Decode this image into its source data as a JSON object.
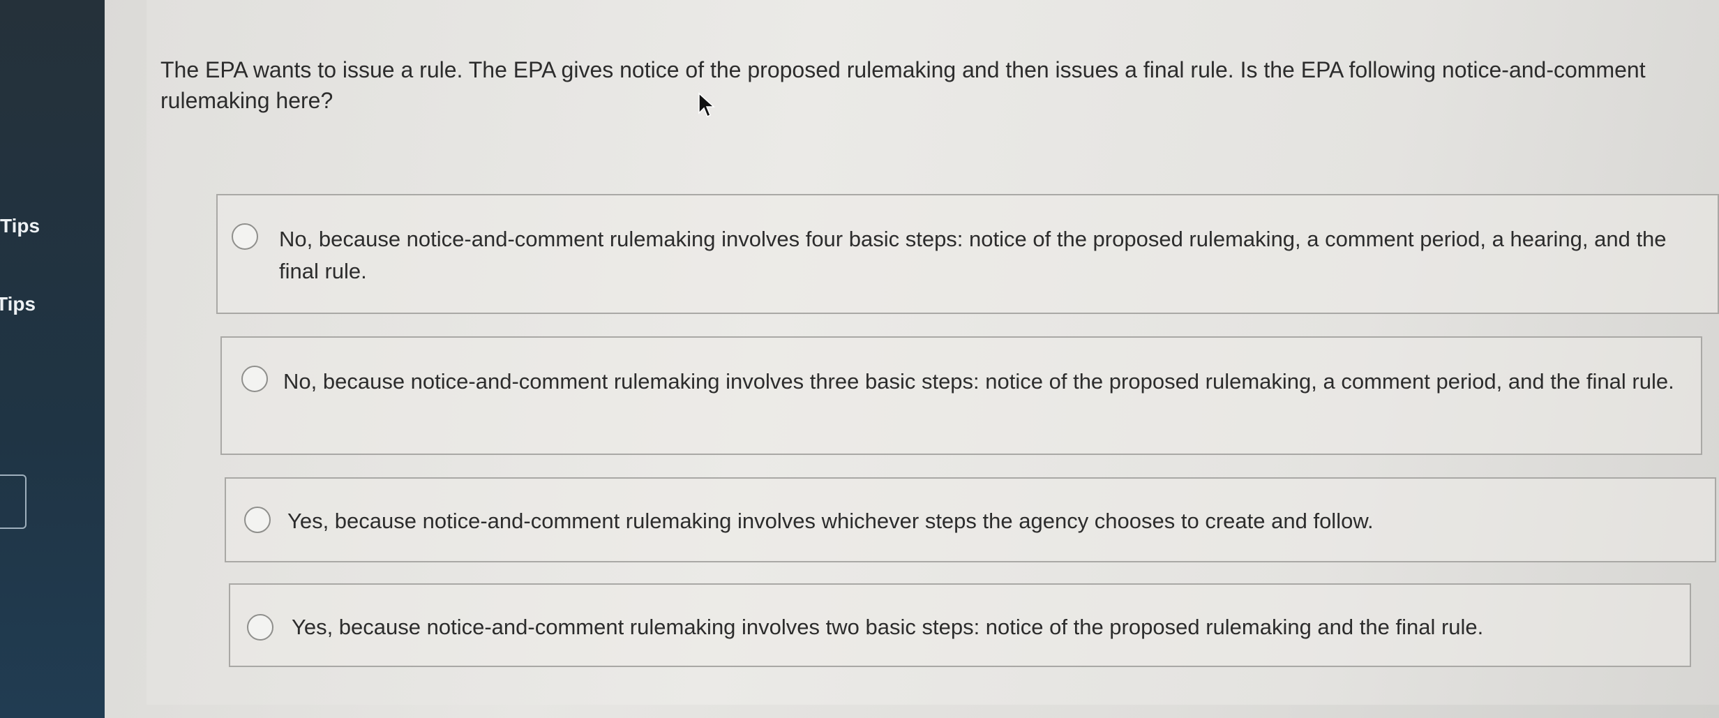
{
  "sidebar": {
    "tabs": [
      "Tips",
      "Tips"
    ]
  },
  "question": {
    "text": "The EPA wants to issue a rule. The EPA gives notice of the proposed rulemaking and then issues a final rule. Is the EPA following notice-and-comment rulemaking here?"
  },
  "options": [
    {
      "label": "No, because notice-and-comment rulemaking involves four basic steps: notice of the proposed rulemaking, a comment period, a hearing, and the final rule."
    },
    {
      "label": "No, because notice-and-comment rulemaking involves three basic steps: notice of the proposed rulemaking, a comment period, and the final rule."
    },
    {
      "label": "Yes, because notice-and-comment rulemaking involves whichever steps the agency chooses to create and follow."
    },
    {
      "label": "Yes, because notice-and-comment rulemaking involves two basic steps: notice of the proposed rulemaking and the final rule."
    }
  ]
}
